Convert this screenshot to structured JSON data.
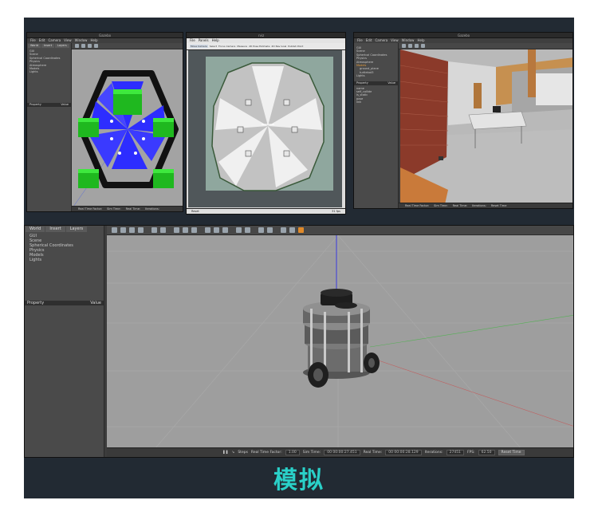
{
  "caption": "模拟",
  "win1": {
    "title": "Gazebo",
    "menu": [
      "File",
      "Edit",
      "Camera",
      "View",
      "Window",
      "Help"
    ],
    "tabs": [
      "World",
      "Insert",
      "Layers"
    ],
    "tree": [
      "GUI",
      "Scene",
      "Spherical Coordinates",
      "Physics",
      "Atmosphere",
      "Models",
      "Lights"
    ],
    "prop_header": [
      "Property",
      "Value"
    ],
    "status": [
      "Real Time Factor:",
      "Sim Time:",
      "Real Time:",
      "Iterations:"
    ]
  },
  "win2": {
    "title": "rviz",
    "menu": [
      "File",
      "Panels",
      "Help"
    ],
    "tools": [
      "Move Camera",
      "Select",
      "Focus Camera",
      "Measure",
      "2D Pose Estimate",
      "2D Nav Goal",
      "Publish Point",
      "2D Pose Estimate"
    ],
    "status_left": "Reset",
    "status_right": "31 fps"
  },
  "win3": {
    "title": "Gazebo",
    "menu": [
      "File",
      "Edit",
      "Camera",
      "View",
      "Window",
      "Help"
    ],
    "tree": [
      "GUI",
      "Scene",
      "Spherical Coordinates",
      "Physics",
      "Atmosphere",
      "Models",
      "ground_plane",
      "turtlebot3",
      "Lights"
    ],
    "prop_header": [
      "Property",
      "Value"
    ],
    "props": [
      "name",
      "self_collide",
      "is_static",
      "pose",
      "link"
    ],
    "status": [
      "Real Time Factor:",
      "Sim Time:",
      "Real Time:",
      "Iterations:",
      "Reset Time"
    ]
  },
  "win4": {
    "tabs": [
      "World",
      "Insert",
      "Layers"
    ],
    "tree": [
      "GUI",
      "Scene",
      "Spherical Coordinates",
      "Physics",
      "Models",
      "Lights"
    ],
    "prop_header": [
      "Property",
      "Value"
    ],
    "status": {
      "steps_label": "Steps",
      "rtf_label": "Real Time Factor:",
      "rtf_value": "1.00",
      "sim_label": "Sim Time:",
      "sim_value": "00 00:00:27.451",
      "real_label": "Real Time:",
      "real_value": "00 00:00:28.129",
      "iter_label": "Iterations:",
      "iter_value": "27451",
      "fps_label": "FPS:",
      "fps_value": "62.50",
      "reset": "Reset Time"
    }
  },
  "colors": {
    "frame_bg": "#222a33",
    "caption": "#2ad0c8",
    "gazebo_bg": "#9e9e9e",
    "rviz_grid": "#8fa79e",
    "cube_green": "#22cc22",
    "fan_blue": "#2d2dff"
  }
}
